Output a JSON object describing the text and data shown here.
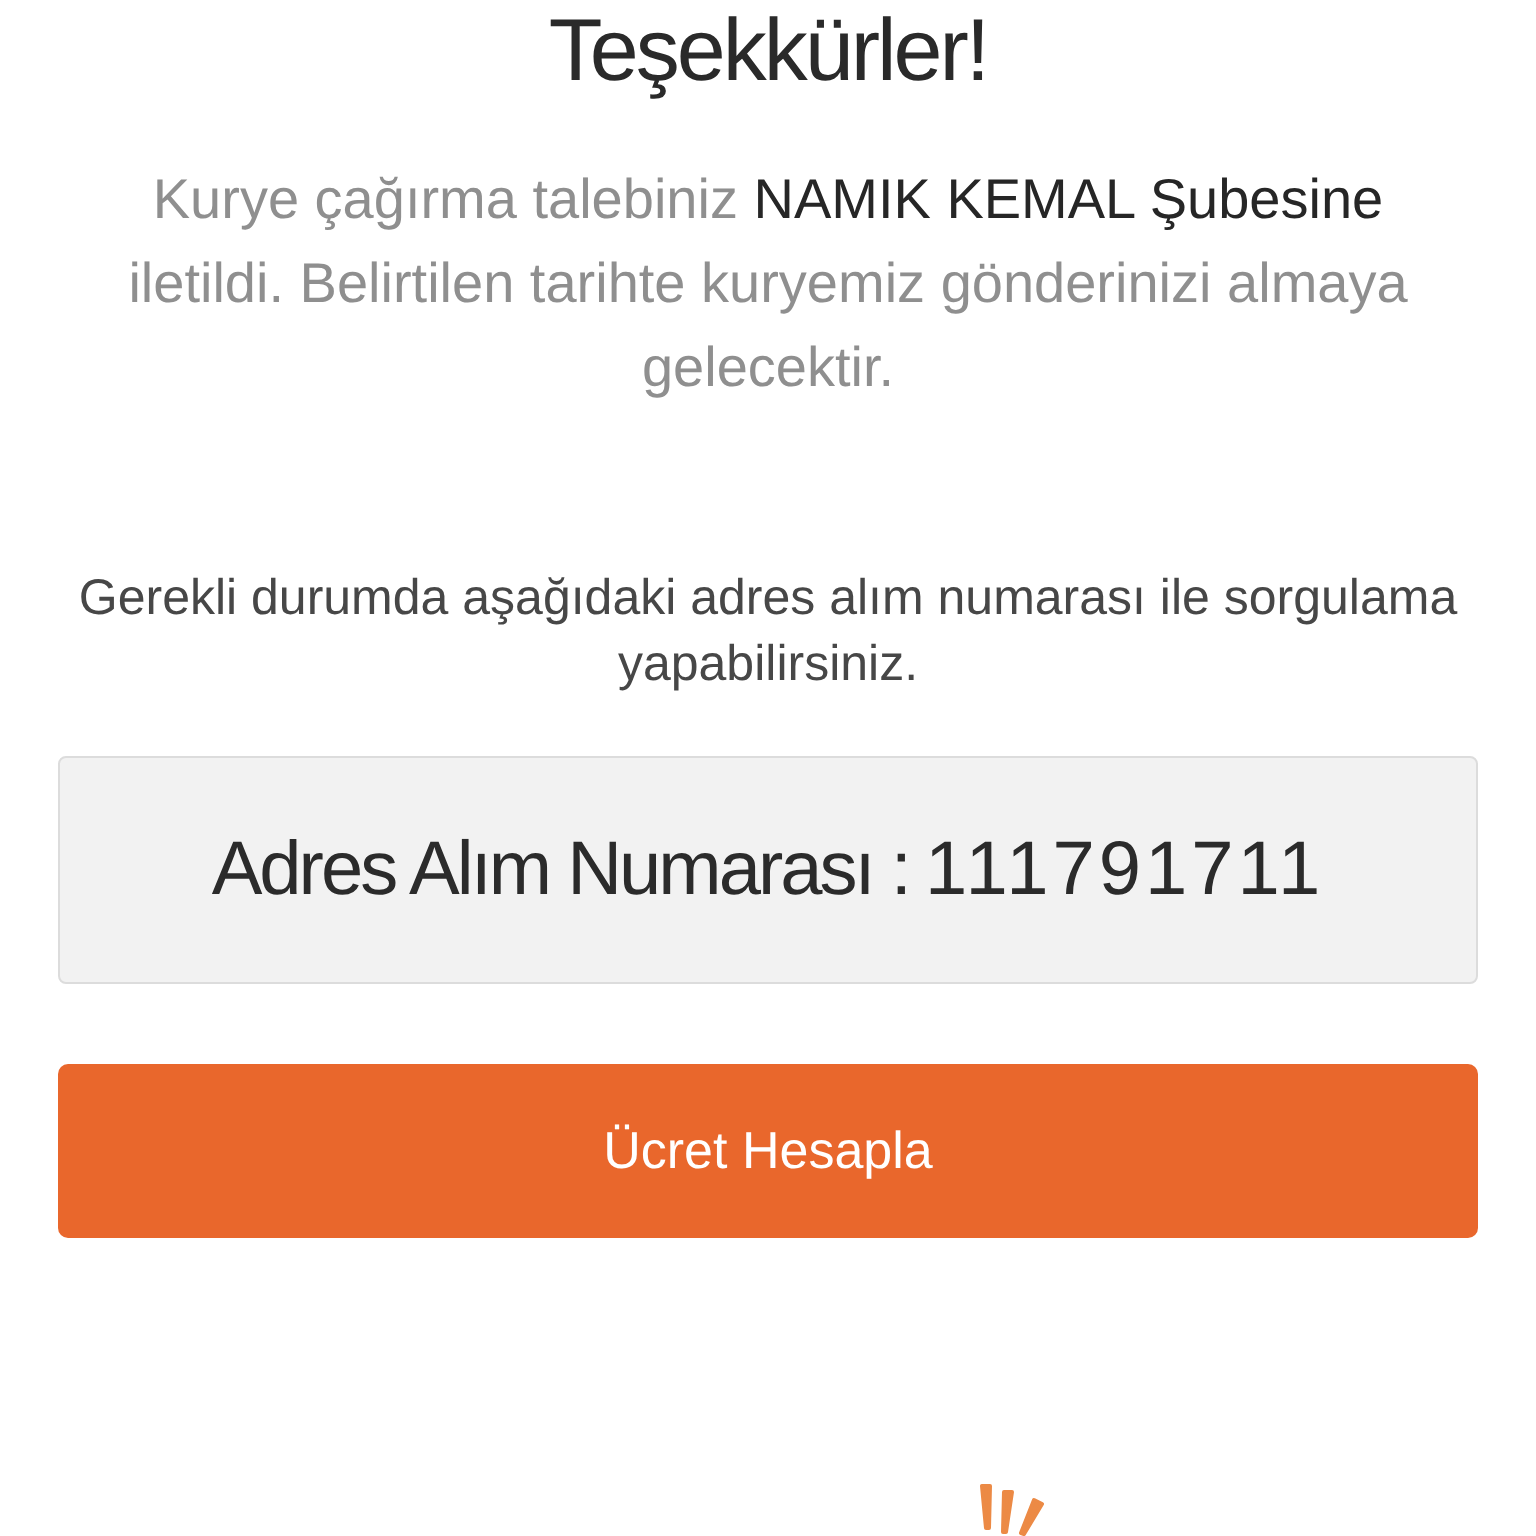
{
  "title": "Teşekkürler!",
  "message": "Kurye çağırma talebiniz **NAMIK KEMAL Şubesine** iletildi. Belirtilen tarihte kuryemiz gönderinizi almaya gelecektir.",
  "hint": "Gerekli durumda aşağıdaki adres alım numarası ile sorgulama yapabilirsiniz.",
  "address_number": {
    "label": "Adres Alım Numarası :",
    "value": "111791711"
  },
  "button": {
    "label": "Ücret Hesapla"
  }
}
